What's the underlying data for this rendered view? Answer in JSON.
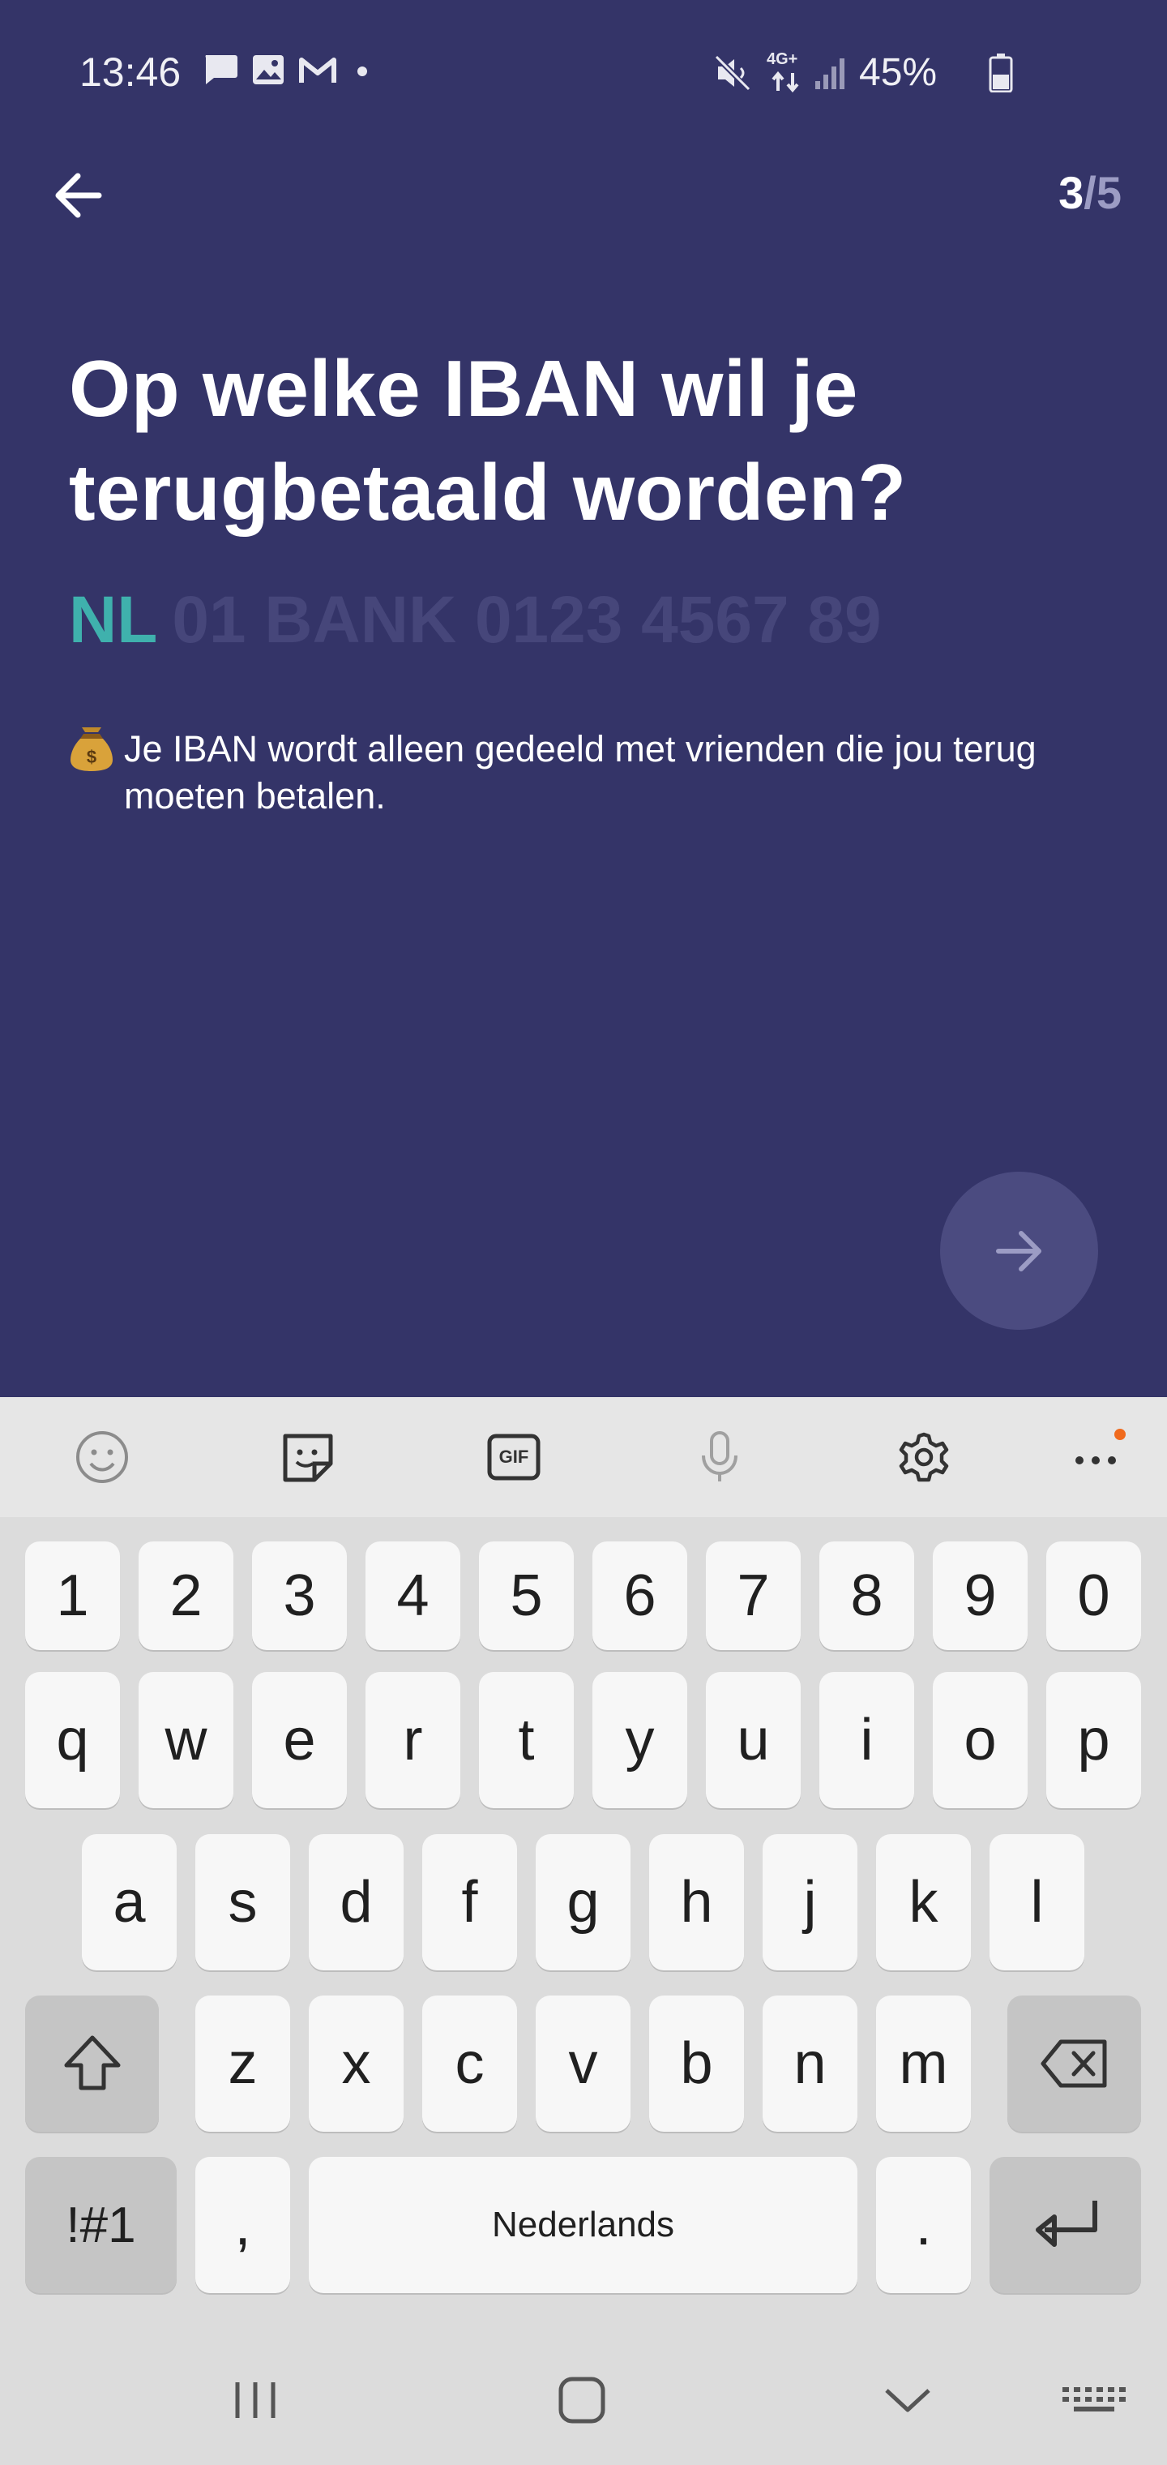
{
  "status_bar": {
    "time": "13:46",
    "battery": "45%",
    "network": "4G+",
    "icons_left": [
      "message-icon",
      "image-icon",
      "gmail-icon",
      "dot-icon"
    ],
    "icons_right": [
      "mute-icon",
      "4g-icon",
      "signal-icon",
      "battery-icon"
    ]
  },
  "header": {
    "step_current": "3",
    "step_separator": "/",
    "step_total": "5"
  },
  "main": {
    "question": "Op welke IBAN wil je terugbetaald worden?",
    "iban_prefix": "NL",
    "iban_placeholder": "01 BANK 0123 4567 89",
    "iban_value": "",
    "info_icon": "money-bag-icon",
    "info_text": "Je IBAN wordt alleen gedeeld met vrienden die jou terug moeten betalen."
  },
  "keyboard": {
    "toolbar": [
      "emoji-icon",
      "sticker-icon",
      "gif-icon",
      "microphone-icon",
      "settings-icon",
      "more-icon"
    ],
    "gif_label": "GIF",
    "row_numbers": [
      "1",
      "2",
      "3",
      "4",
      "5",
      "6",
      "7",
      "8",
      "9",
      "0"
    ],
    "row_top": [
      "q",
      "w",
      "e",
      "r",
      "t",
      "y",
      "u",
      "i",
      "o",
      "p"
    ],
    "row_middle": [
      "a",
      "s",
      "d",
      "f",
      "g",
      "h",
      "j",
      "k",
      "l"
    ],
    "row_bottom": [
      "z",
      "x",
      "c",
      "v",
      "b",
      "n",
      "m"
    ],
    "symbols_label": "!#1",
    "comma": ",",
    "space_label": "Nederlands",
    "period": "."
  },
  "colors": {
    "background": "#343468",
    "accent": "#3fb1ad",
    "next_button": "#4b4b80",
    "notification_dot": "#f06a1d"
  }
}
